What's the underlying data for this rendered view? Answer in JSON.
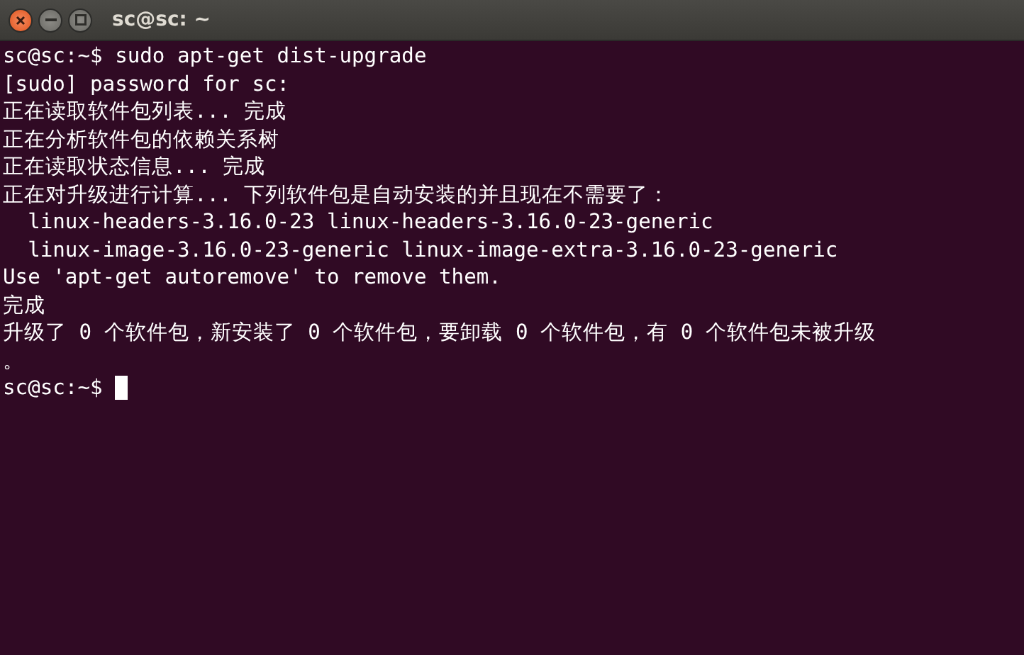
{
  "window": {
    "title": "sc@sc: ~"
  },
  "terminal": {
    "lines": [
      "sc@sc:~$ sudo apt-get dist-upgrade",
      "[sudo] password for sc:",
      "正在读取软件包列表... 完成",
      "正在分析软件包的依赖关系树",
      "正在读取状态信息... 完成",
      "正在对升级进行计算... 下列软件包是自动安装的并且现在不需要了：",
      "  linux-headers-3.16.0-23 linux-headers-3.16.0-23-generic",
      "  linux-image-3.16.0-23-generic linux-image-extra-3.16.0-23-generic",
      "Use 'apt-get autoremove' to remove them.",
      "完成",
      "升级了 0 个软件包，新安装了 0 个软件包，要卸载 0 个软件包，有 0 个软件包未被升级",
      "。",
      "sc@sc:~$"
    ],
    "cursor_visible": true
  }
}
